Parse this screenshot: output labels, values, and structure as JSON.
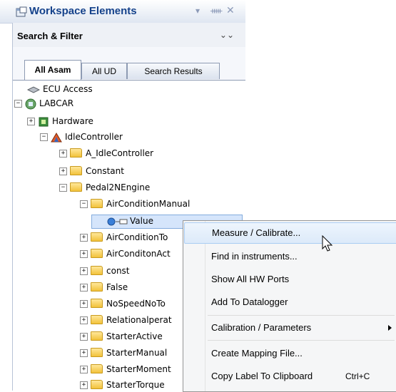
{
  "panel": {
    "title": "Workspace Elements",
    "pin_glyph": "▾ ⊓ ✕",
    "search_filter_label": "Search & Filter",
    "expand_glyph": "≫"
  },
  "tabs": [
    {
      "label": "All Asam",
      "active": true
    },
    {
      "label": "All UD",
      "active": false
    },
    {
      "label": "Search Results",
      "active": false
    }
  ],
  "tree": [
    {
      "label": "ECU Access",
      "icon": "ecu-access-icon"
    },
    {
      "label": "LABCAR",
      "icon": "labcar-icon",
      "expander": "minus"
    },
    {
      "label": "Hardware",
      "icon": "hardware-icon",
      "expander": "plus"
    },
    {
      "label": "IdleController",
      "icon": "model-icon",
      "expander": "minus"
    },
    {
      "label": "A_IdleController",
      "icon": "folder-icon",
      "expander": "plus"
    },
    {
      "label": "Constant",
      "icon": "folder-icon",
      "expander": "plus"
    },
    {
      "label": "Pedal2NEngine",
      "icon": "folder-icon",
      "expander": "minus"
    },
    {
      "label": "AirConditionManual",
      "icon": "folder-icon",
      "expander": "minus"
    },
    {
      "label": "Value",
      "icon": "value-icon"
    },
    {
      "label": "AirConditionTo",
      "icon": "folder-icon",
      "expander": "plus"
    },
    {
      "label": "AirConditonAct",
      "icon": "folder-icon",
      "expander": "plus"
    },
    {
      "label": "const",
      "icon": "folder-icon",
      "expander": "plus"
    },
    {
      "label": "False",
      "icon": "folder-icon",
      "expander": "plus"
    },
    {
      "label": "NoSpeedNoTo",
      "icon": "folder-icon",
      "expander": "plus"
    },
    {
      "label": "Relationalperat",
      "icon": "folder-icon",
      "expander": "plus"
    },
    {
      "label": "StarterActive",
      "icon": "folder-icon",
      "expander": "plus"
    },
    {
      "label": "StarterManual",
      "icon": "folder-icon",
      "expander": "plus"
    },
    {
      "label": "StarterMoment",
      "icon": "folder-icon",
      "expander": "plus"
    },
    {
      "label": "StarterTorque",
      "icon": "folder-icon",
      "expander": "plus"
    }
  ],
  "context_menu": [
    {
      "label": "Measure / Calibrate...",
      "highlighted": true
    },
    {
      "label": "Find in instruments..."
    },
    {
      "label": "Show All HW Ports"
    },
    {
      "label": "Add To Datalogger"
    },
    {
      "label": "Calibration / Parameters",
      "submenu": true
    },
    {
      "label": "Create Mapping File..."
    },
    {
      "label": "Copy Label To Clipboard",
      "shortcut": "Ctrl+C"
    }
  ],
  "colors": {
    "title_text": "#15428b",
    "selection": "#d5e5fb",
    "menu_highlight": "#dceaf9"
  }
}
